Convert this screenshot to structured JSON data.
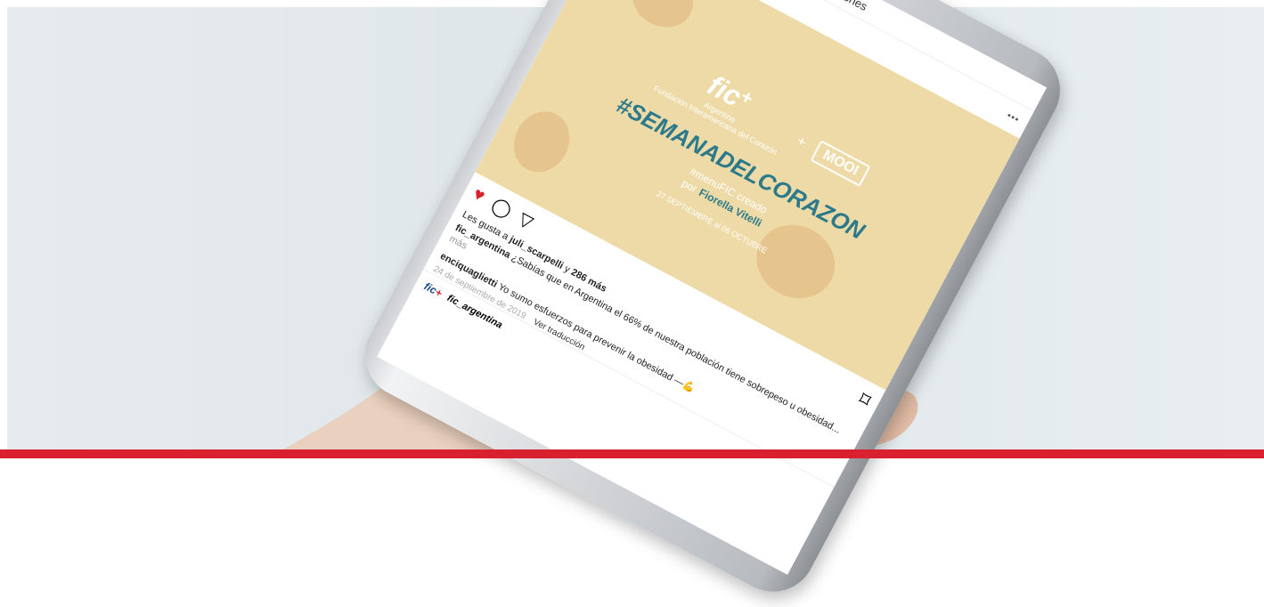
{
  "screen": {
    "title": "Publicaciones",
    "account": {
      "logo_text": "fic",
      "logo_plus": "+",
      "handle": "fic_argentina",
      "more": "•••"
    },
    "art": {
      "fic_logo": "fic",
      "fic_plus": "+",
      "fic_sub1": "Argentina",
      "fic_sub2": "Fundación Interamericana del Corazón",
      "times": "+",
      "mooi_logo": "MOOI",
      "hashtag": "#SEMANADELCORAZON",
      "created_line": "#menuFIC creado",
      "by_label": "por",
      "author": "Fiorella Vitelli",
      "dates": "27 SEPTIEMBRE al 06 OCTUBRE"
    },
    "actions": {
      "like": "♥",
      "comment": "◯",
      "share": "▽",
      "bookmark": "⌑"
    },
    "likes_text_prefix": "Les gusta a",
    "likes_user": "juli_scarpelli",
    "likes_middle": "y",
    "likes_count": "286 más",
    "caption_user": "fic_argentina",
    "caption_text": "¿Sabías que en Argentina el 66% de nuestra población tiene sobrepeso u obesidad...",
    "caption_more": "más",
    "comment_user": "enciquaglietti",
    "comment_text": "Yo sumo esfuerzos para prevenir la obesidad —💪",
    "date": "24 de septiembre de 2019",
    "translate": "Ver traducción",
    "next_handle": "fic_argentina",
    "colors": {
      "accent_red": "#d8202e",
      "art_bg": "#eedaa6",
      "teal": "#2a7a8c"
    }
  }
}
